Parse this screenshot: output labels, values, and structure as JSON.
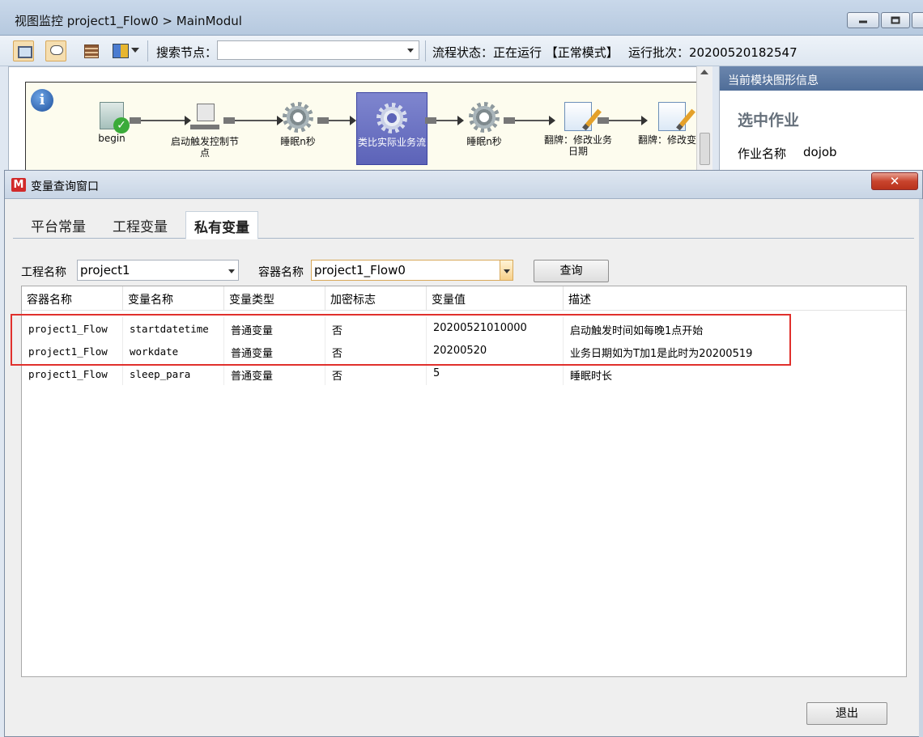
{
  "background_window": {
    "title": "视图监控  project1_Flow0 > MainModul",
    "toolbar": {
      "search_label": "搜索节点：",
      "search_value": "",
      "status_text": "流程状态：正在运行 【正常模式】",
      "batch_text": "运行批次：20200520182547"
    },
    "flow_nodes": [
      {
        "label": "begin",
        "icon": "document-check-icon"
      },
      {
        "label": "启动触发控制节点",
        "icon": "computer-icon"
      },
      {
        "label": "睡眠n秒",
        "icon": "gear-icon"
      },
      {
        "label": "类比实际业务流",
        "icon": "gear-icon",
        "active": true
      },
      {
        "label": "睡眠n秒",
        "icon": "gear-icon"
      },
      {
        "label": "翻牌：修改业务日期",
        "icon": "edit-document-icon"
      },
      {
        "label": "翻牌：修改变量",
        "icon": "edit-document-icon"
      }
    ],
    "info_panel": {
      "header": "当前模块图形信息",
      "subtitle": "选中作业",
      "job_name_label": "作业名称",
      "job_name_value": "dojob"
    }
  },
  "dialog": {
    "title": "变量查询窗口",
    "close_label": "✕",
    "tabs": [
      "平台常量",
      "工程变量",
      "私有变量"
    ],
    "selected_tab": "私有变量",
    "filters": {
      "project_label": "工程名称",
      "project_value": "project1",
      "container_label": "容器名称",
      "container_value": "project1_Flow0",
      "query_button": "查询"
    },
    "table": {
      "columns": [
        "容器名称",
        "变量名称",
        "变量类型",
        "加密标志",
        "变量值",
        "描述"
      ],
      "rows": [
        [
          "project1_Flow",
          "startdatetime",
          "普通变量",
          "否",
          "20200521010000",
          "启动触发时间如每晚1点开始"
        ],
        [
          "project1_Flow",
          "workdate",
          "普通变量",
          "否",
          "20200520",
          "业务日期如为T加1是此时为20200519"
        ],
        [
          "project1_Flow",
          "sleep_para",
          "普通变量",
          "否",
          "5",
          "睡眠时长"
        ]
      ],
      "highlighted_rows": [
        0,
        1
      ],
      "highlight_color": "#e0302c"
    },
    "exit_button": "退出"
  }
}
